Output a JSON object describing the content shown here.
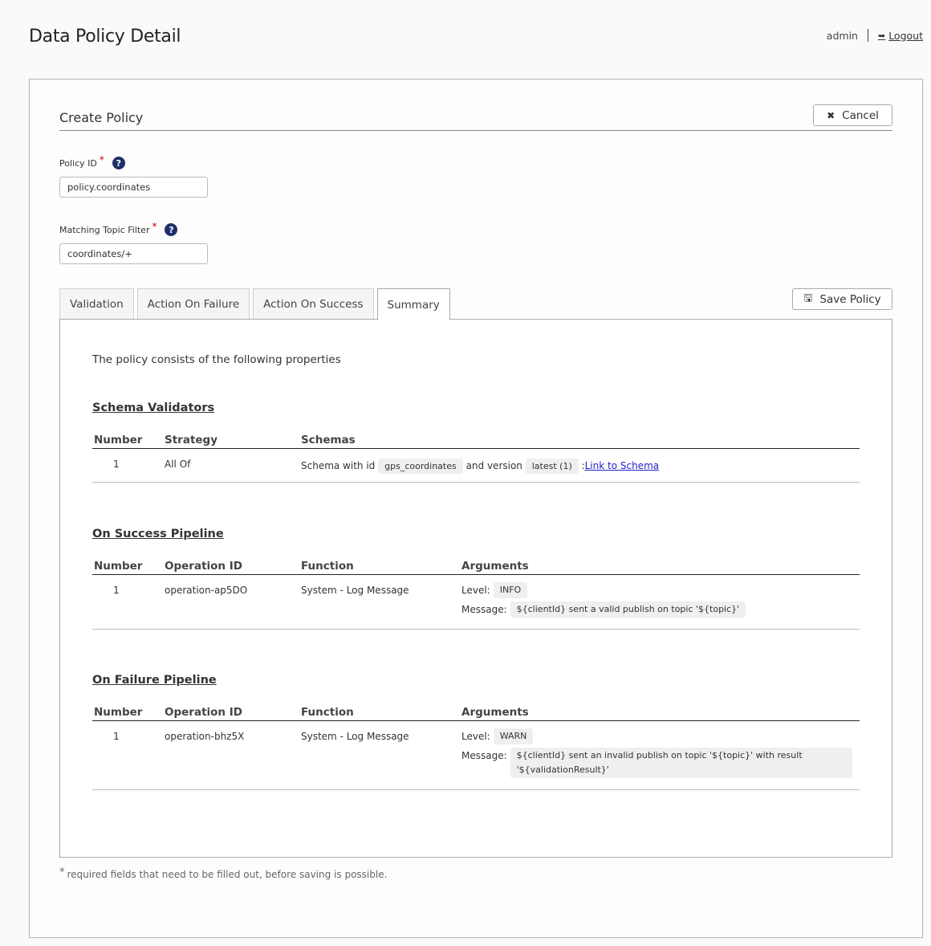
{
  "header": {
    "title": "Data Policy Detail",
    "user": "admin",
    "logout_label": "Logout",
    "logout_icon": "sign-out-icon"
  },
  "form": {
    "section_title": "Create Policy",
    "cancel_label": "Cancel",
    "cancel_icon": "close-icon",
    "required_marker": "*",
    "help_glyph": "?",
    "policy_id": {
      "label": "Policy ID",
      "value": "policy.coordinates"
    },
    "topic_filter": {
      "label": "Matching Topic Filter",
      "value": "coordinates/+"
    },
    "save_label": "Save Policy",
    "save_icon": "floppy-disk-icon",
    "footnote": "required fields that need to be filled out, before saving is possible."
  },
  "tabs": [
    {
      "label": "Validation",
      "active": false
    },
    {
      "label": "Action On Failure",
      "active": false
    },
    {
      "label": "Action On Success",
      "active": false
    },
    {
      "label": "Summary",
      "active": true
    }
  ],
  "summary": {
    "intro": "The policy consists of the following properties",
    "schema_validators": {
      "title": "Schema Validators",
      "headers": [
        "Number",
        "Strategy",
        "Schemas"
      ],
      "rows": [
        {
          "number": "1",
          "strategy": "All Of",
          "prefix": "Schema with id",
          "schema_id": "gps_coordinates",
          "middle": "and version",
          "version": "latest (1)",
          "separator": ":",
          "link": "Link to Schema"
        }
      ]
    },
    "on_success": {
      "title": "On Success Pipeline",
      "headers": [
        "Number",
        "Operation ID",
        "Function",
        "Arguments"
      ],
      "rows": [
        {
          "number": "1",
          "operation_id": "operation-ap5DO",
          "function": "System - Log Message",
          "level_label": "Level:",
          "level": "INFO",
          "message_label": "Message:",
          "message": "${clientId} sent a valid publish on topic '${topic}'"
        }
      ]
    },
    "on_failure": {
      "title": "On Failure Pipeline",
      "headers": [
        "Number",
        "Operation ID",
        "Function",
        "Arguments"
      ],
      "rows": [
        {
          "number": "1",
          "operation_id": "operation-bhz5X",
          "function": "System - Log Message",
          "level_label": "Level:",
          "level": "WARN",
          "message_label": "Message:",
          "message": "${clientId} sent an invalid publish on topic '${topic}' with result '${validationResult}'"
        }
      ]
    }
  }
}
